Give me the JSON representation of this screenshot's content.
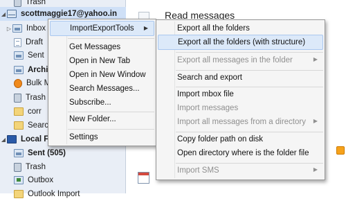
{
  "folder_pane": {
    "items": [
      {
        "label": "Trash",
        "icon": "trash-icon"
      },
      {
        "label": "scottmaggie17@yahoo.in",
        "icon": "account-icon"
      },
      {
        "label": "Inbox",
        "icon": "inbox-icon"
      },
      {
        "label": "Draft",
        "icon": "draft-icon"
      },
      {
        "label": "Sent",
        "icon": "sent-icon"
      },
      {
        "label": "Archive",
        "icon": "archive-icon"
      },
      {
        "label": "Bulk Mail",
        "icon": "junk-icon"
      },
      {
        "label": "Trash",
        "icon": "trash-icon"
      },
      {
        "label": "corr",
        "icon": "folder-icon"
      },
      {
        "label": "Search",
        "icon": "folder-icon"
      },
      {
        "label": "Local Folders",
        "icon": "local-folders-icon"
      },
      {
        "label": "Sent (505)",
        "icon": "sent-icon"
      },
      {
        "label": "Trash",
        "icon": "trash-icon"
      },
      {
        "label": "Outbox",
        "icon": "outbox-icon"
      },
      {
        "label": "Outlook Import",
        "icon": "folder-icon"
      }
    ]
  },
  "main": {
    "title": "Read messages"
  },
  "context_menu": {
    "items": [
      {
        "label": "ImportExportTools",
        "has_submenu": true
      },
      {
        "label": "Get Messages"
      },
      {
        "label": "Open in New Tab"
      },
      {
        "label": "Open in New Window"
      },
      {
        "label": "Search Messages..."
      },
      {
        "label": "Subscribe..."
      },
      {
        "label": "New Folder..."
      },
      {
        "label": "Settings"
      }
    ],
    "submenu_arrow": "▶"
  },
  "submenu": {
    "items": [
      {
        "label": "Export all the folders",
        "enabled": true
      },
      {
        "label": "Export all the folders (with structure)",
        "enabled": true
      },
      {
        "label": "Export all messages in the folder",
        "enabled": false,
        "has_submenu": true
      },
      {
        "label": "Search and export",
        "enabled": true
      },
      {
        "label": "Import mbox file",
        "enabled": true
      },
      {
        "label": "Import messages",
        "enabled": false
      },
      {
        "label": "Import all messages from a directory",
        "enabled": false,
        "has_submenu": true
      },
      {
        "label": "Copy folder path on disk",
        "enabled": true
      },
      {
        "label": "Open directory where is the folder file",
        "enabled": true
      },
      {
        "label": "Import SMS",
        "enabled": false,
        "has_submenu": true
      }
    ],
    "submenu_arrow": "▶"
  },
  "colors": {
    "highlight": "#dce9f9",
    "folder_pane_bg": "#e9eef6",
    "disabled_text": "#8f8f8f"
  }
}
